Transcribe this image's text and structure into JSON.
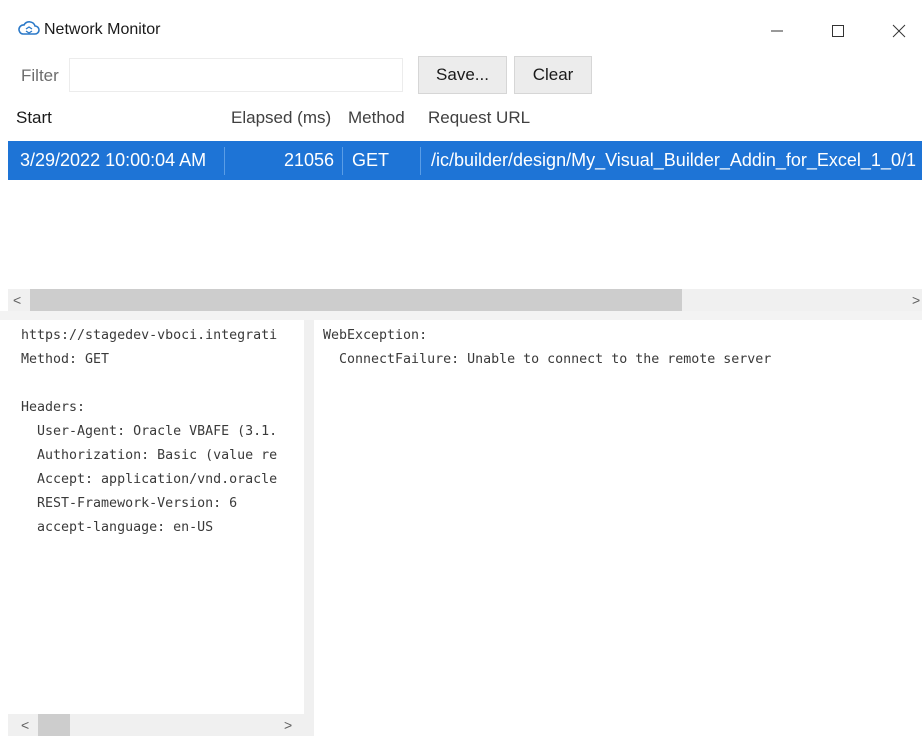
{
  "window": {
    "title": "Network Monitor",
    "icon": "cloud-icon",
    "controls": {
      "minimize": "—",
      "maximize": "☐",
      "close": "✕"
    }
  },
  "toolbar": {
    "filter_label": "Filter",
    "filter_value": "",
    "save_label": "Save...",
    "clear_label": "Clear"
  },
  "table": {
    "columns": [
      "Start",
      "Elapsed (ms)",
      "Method",
      "Request URL"
    ],
    "rows": [
      {
        "start": "3/29/2022 10:00:04 AM",
        "elapsed": "21056",
        "method": "GET",
        "url": "/ic/builder/design/My_Visual_Builder_Addin_for_Excel_1_0/1"
      }
    ],
    "selected_color": "#1e74d6"
  },
  "request_details": {
    "text": "https://stagedev-vboci.integrati\nMethod: GET\n\nHeaders:\n  User-Agent: Oracle VBAFE (3.1.\n  Authorization: Basic (value re\n  Accept: application/vnd.oracle\n  REST-Framework-Version: 6\n  accept-language: en-US"
  },
  "response_details": {
    "text": "WebException:\n  ConnectFailure: Unable to connect to the remote server"
  },
  "scroll": {
    "left_arrow": "<",
    "right_arrow": ">"
  }
}
